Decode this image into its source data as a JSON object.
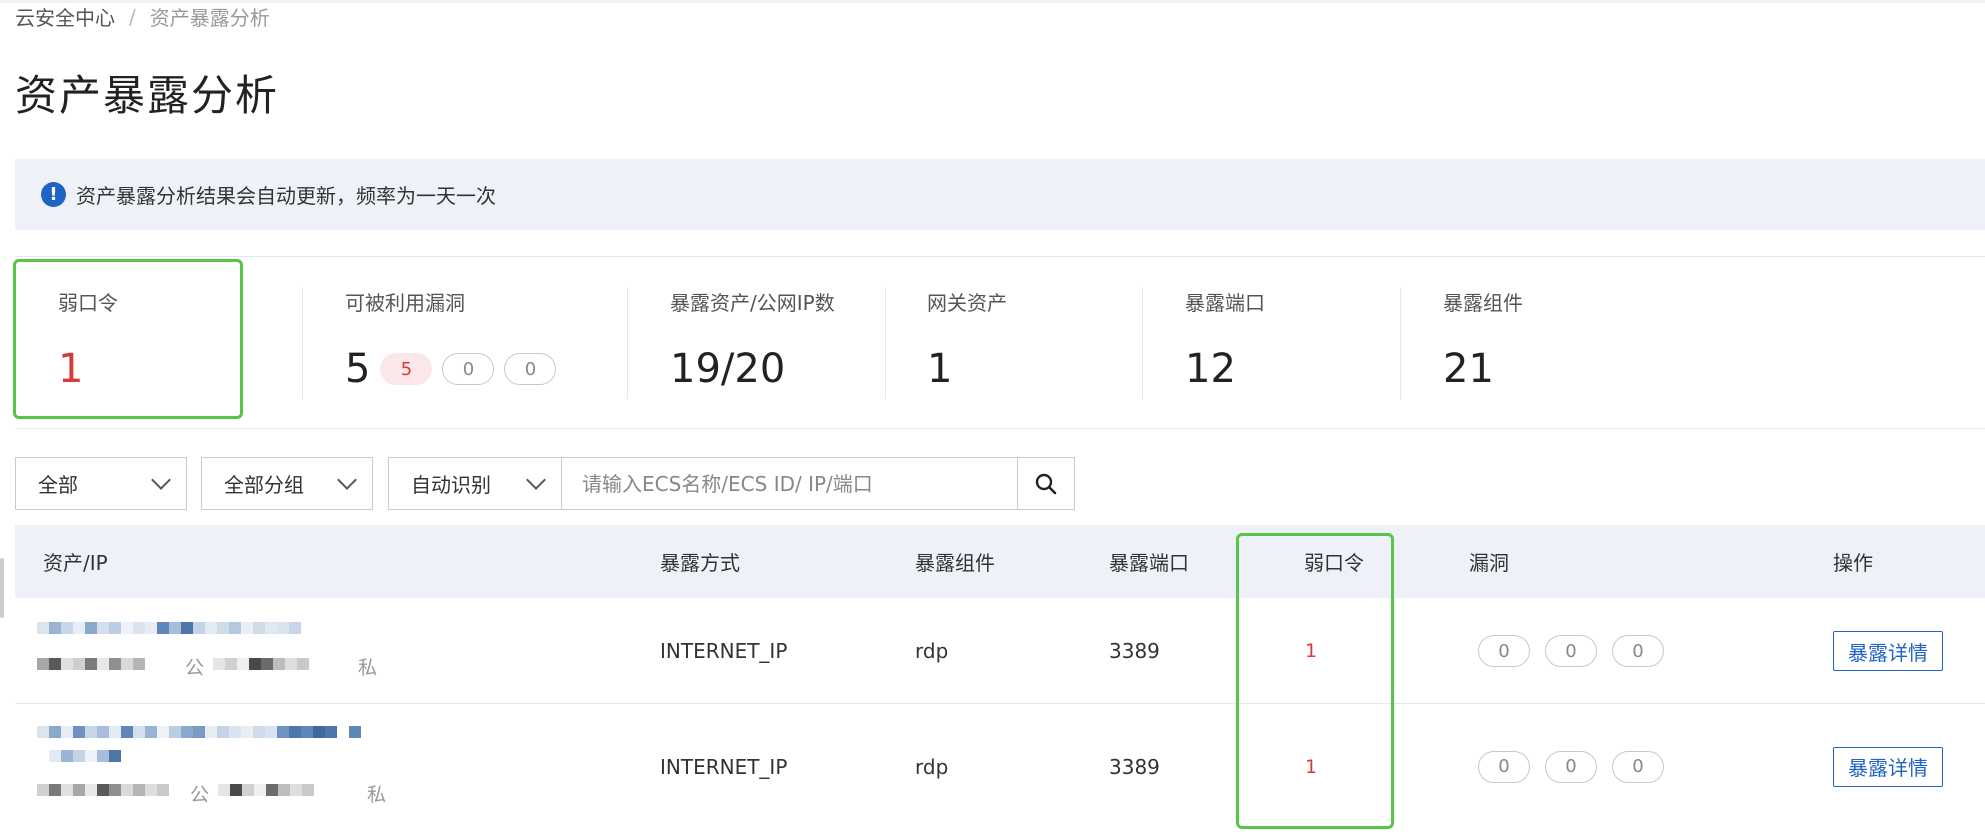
{
  "breadcrumb": {
    "root": "云安全中心",
    "separator": "/",
    "current": "资产暴露分析"
  },
  "page_title": "资产暴露分析",
  "notice": {
    "icon": "info-icon",
    "text": "资产暴露分析结果会自动更新，频率为一天一次"
  },
  "stats": {
    "weak_password": {
      "label": "弱口令",
      "value": "1"
    },
    "exploitable_vulns": {
      "label": "可被利用漏洞",
      "value": "5",
      "badges": [
        "5",
        "0",
        "0"
      ]
    },
    "exposed_assets": {
      "label": "暴露资产/公网IP数",
      "value": "19/20"
    },
    "gateway_assets": {
      "label": "网关资产",
      "value": "1"
    },
    "exposed_ports": {
      "label": "暴露端口",
      "value": "12"
    },
    "exposed_components": {
      "label": "暴露组件",
      "value": "21"
    }
  },
  "filters": {
    "scope": "全部",
    "group": "全部分组",
    "mode": "自动识别",
    "search_placeholder": "请输入ECS名称/ECS ID/ IP/端口"
  },
  "table": {
    "headers": {
      "asset": "资产/IP",
      "method": "暴露方式",
      "component": "暴露组件",
      "port": "暴露端口",
      "weak_password": "弱口令",
      "vuln": "漏洞",
      "action": "操作"
    },
    "rows": [
      {
        "public_tag": "公",
        "private_tag": "私",
        "method": "INTERNET_IP",
        "component": "rdp",
        "port": "3389",
        "weak_password": "1",
        "vulns": [
          "0",
          "0",
          "0"
        ],
        "action": "暴露详情"
      },
      {
        "public_tag": "公",
        "private_tag": "私",
        "method": "INTERNET_IP",
        "component": "rdp",
        "port": "3389",
        "weak_password": "1",
        "vulns": [
          "0",
          "0",
          "0"
        ],
        "action": "暴露详情"
      }
    ]
  }
}
